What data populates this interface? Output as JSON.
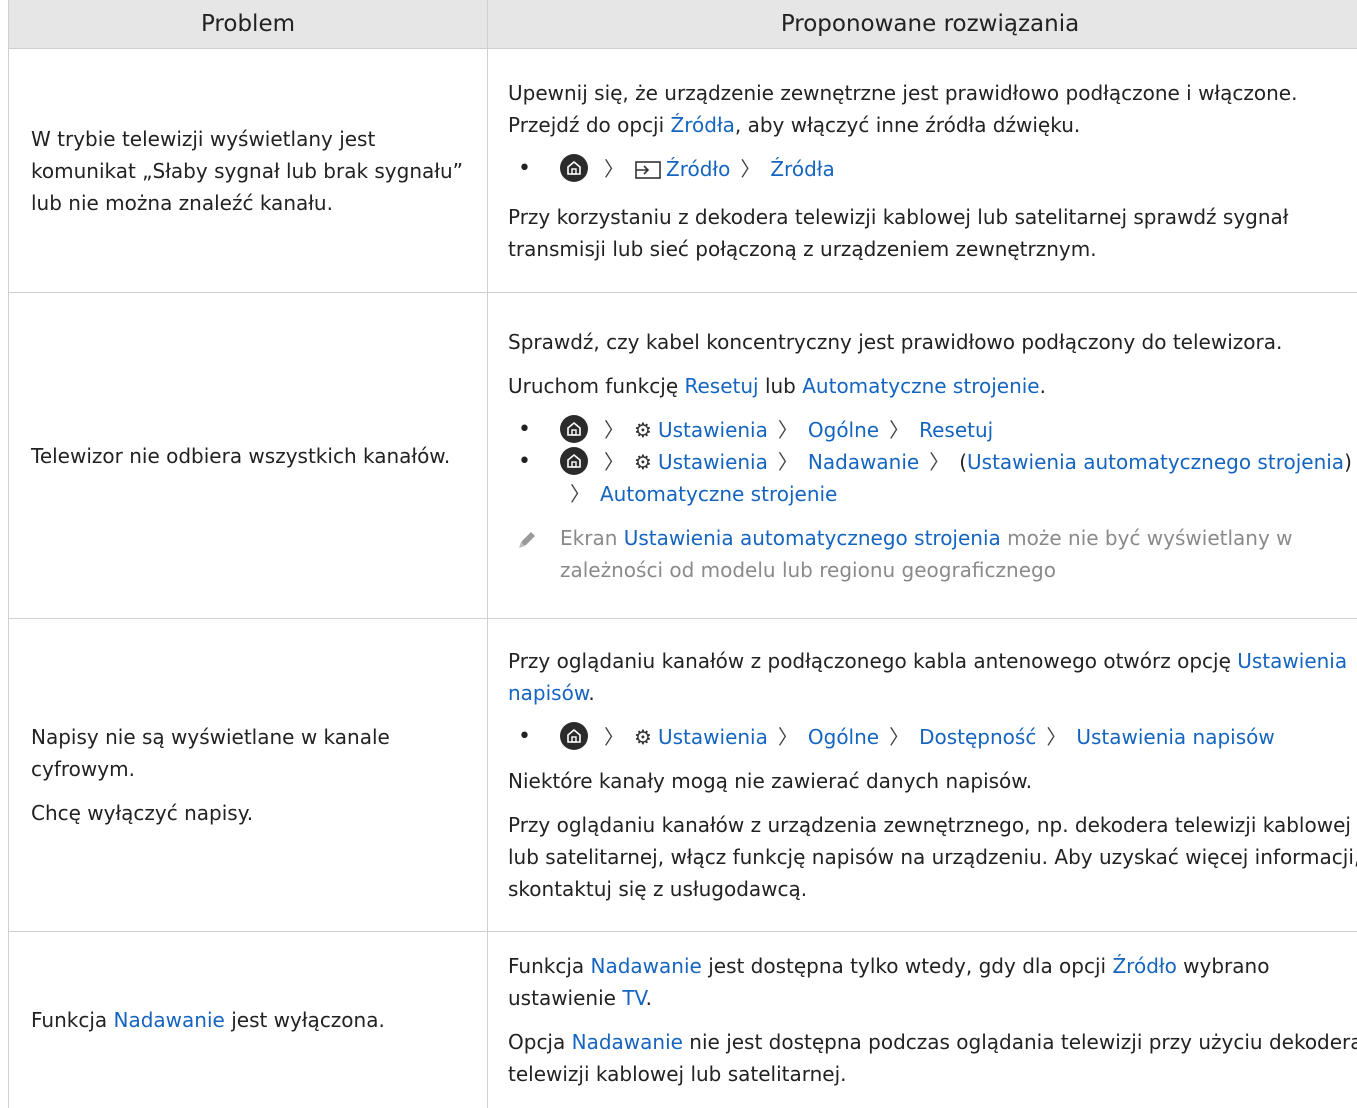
{
  "headers": {
    "problem": "Problem",
    "solutions": "Proponowane rozwiązania"
  },
  "rows": [
    {
      "problem": "W trybie telewizji wyświetlany jest komunikat „Słaby sygnał lub brak sygnału” lub nie można znaleźć kanału.",
      "s1a": "Upewnij się, że urządzenie zewnętrzne jest prawidłowo podłączone i włączone. Przejdź do opcji ",
      "s1_link": "Źródła",
      "s1b": ", aby włączyć inne źródła dźwięku.",
      "path": [
        "Źródło",
        "Źródła"
      ],
      "s2": "Przy korzystaniu z dekodera telewizji kablowej lub satelitarnej sprawdź sygnał transmisji lub sieć połączoną z urządzeniem zewnętrznym."
    },
    {
      "problem": "Telewizor nie odbiera wszystkich kanałów.",
      "s1": "Sprawdź, czy kabel koncentryczny jest prawidłowo podłączony do telewizora.",
      "s2a": "Uruchom funkcję ",
      "s2_link1": "Resetuj",
      "s2b": " lub ",
      "s2_link2": "Automatyczne strojenie",
      "s2c": ".",
      "path1": [
        "Ustawienia",
        "Ogólne",
        "Resetuj"
      ],
      "path2": [
        "Ustawienia",
        "Nadawanie",
        "(",
        "Ustawienia automatycznego strojenia",
        ")",
        "Automatyczne strojenie"
      ],
      "note_a": "Ekran ",
      "note_link": "Ustawienia automatycznego strojenia",
      "note_b": " może nie być wyświetlany w zależności od modelu lub regionu geograficznego"
    },
    {
      "problem1": "Napisy nie są wyświetlane w kanale cyfrowym.",
      "problem2": "Chcę wyłączyć napisy.",
      "s1a": "Przy oglądaniu kanałów z podłączonego kabla antenowego otwórz opcję ",
      "s1_link": "Ustawienia napisów",
      "s1b": ".",
      "path": [
        "Ustawienia",
        "Ogólne",
        "Dostępność",
        "Ustawienia napisów"
      ],
      "s2": "Niektóre kanały mogą nie zawierać danych napisów.",
      "s3": "Przy oglądaniu kanałów z urządzenia zewnętrznego, np. dekodera telewizji kablowej lub satelitarnej, włącz funkcję napisów na urządzeniu. Aby uzyskać więcej informacji, skontaktuj się z usługodawcą."
    },
    {
      "problem_a": "Funkcja ",
      "problem_link": "Nadawanie",
      "problem_b": " jest wyłączona.",
      "s1a": "Funkcja ",
      "s1_link1": "Nadawanie",
      "s1b": " jest dostępna tylko wtedy, gdy dla opcji ",
      "s1_link2": "Źródło",
      "s1c": " wybrano ustawienie ",
      "s1_link3": "TV",
      "s1d": ".",
      "s2a": "Opcja ",
      "s2_link": "Nadawanie",
      "s2b": " nie jest dostępna podczas oglądania telewizji przy użyciu dekodera telewizji kablowej lub satelitarnej."
    }
  ],
  "colors": {
    "link": "#1565c0",
    "header_bg": "#e6e6e6",
    "note": "#8a8a8a"
  }
}
